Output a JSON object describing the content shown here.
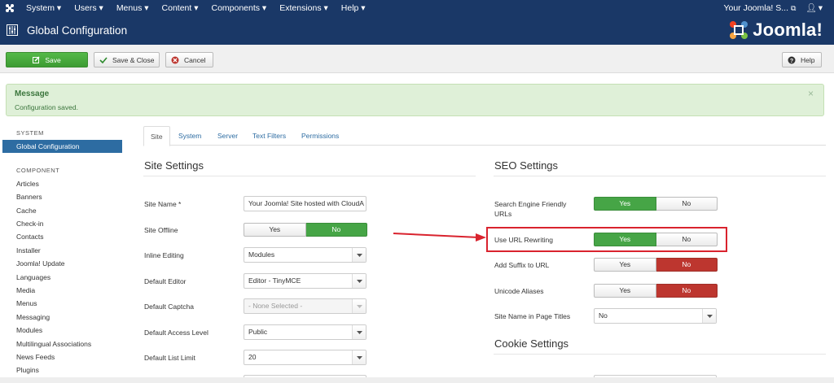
{
  "topnav": {
    "menus": [
      "System ▾",
      "Users ▾",
      "Menus ▾",
      "Content ▾",
      "Components ▾",
      "Extensions ▾",
      "Help ▾"
    ],
    "site_link": "Your Joomla! S...",
    "user_menu": "▾"
  },
  "header": {
    "title": "Global Configuration",
    "brand": "Joomla!"
  },
  "toolbar": {
    "save": "Save",
    "save_close": "Save & Close",
    "cancel": "Cancel",
    "help": "Help"
  },
  "message": {
    "heading": "Message",
    "text": "Configuration saved.",
    "close": "×"
  },
  "sidebar": {
    "system_heading": "SYSTEM",
    "active_item": "Global Configuration",
    "component_heading": "COMPONENT",
    "items": [
      "Articles",
      "Banners",
      "Cache",
      "Check-in",
      "Contacts",
      "Installer",
      "Joomla! Update",
      "Languages",
      "Media",
      "Menus",
      "Messaging",
      "Modules",
      "Multilingual Associations",
      "News Feeds",
      "Plugins"
    ]
  },
  "tabs": [
    "Site",
    "System",
    "Server",
    "Text Filters",
    "Permissions"
  ],
  "site_settings": {
    "title": "Site Settings",
    "site_name_label": "Site Name *",
    "site_name_value": "Your Joomla! Site hosted with CloudA",
    "site_offline_label": "Site Offline",
    "inline_editing_label": "Inline Editing",
    "inline_editing_value": "Modules",
    "default_editor_label": "Default Editor",
    "default_editor_value": "Editor - TinyMCE",
    "default_captcha_label": "Default Captcha",
    "default_captcha_value": "- None Selected -",
    "default_access_label": "Default Access Level",
    "default_access_value": "Public",
    "default_list_label": "Default List Limit",
    "default_list_value": "20"
  },
  "seo_settings": {
    "title": "SEO Settings",
    "sef_label": "Search Engine Friendly URLs",
    "url_rewriting_label": "Use URL Rewriting",
    "add_suffix_label": "Add Suffix to URL",
    "unicode_label": "Unicode Aliases",
    "site_name_titles_label": "Site Name in Page Titles",
    "site_name_titles_value": "No"
  },
  "cookie_settings": {
    "title": "Cookie Settings"
  },
  "toggle": {
    "yes": "Yes",
    "no": "No"
  },
  "colors": {
    "nav": "#1a3867",
    "save": "#46a546",
    "active_red": "#bd362f",
    "highlight": "#d9232e",
    "sidebar_active": "#2d6ca2"
  }
}
